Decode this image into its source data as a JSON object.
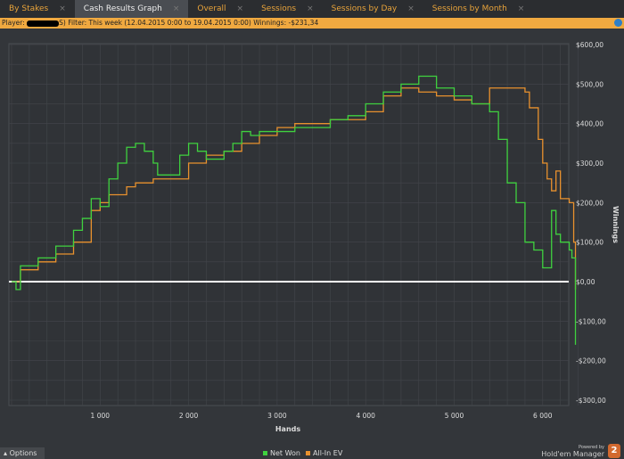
{
  "tabs": [
    {
      "label": "By Stakes"
    },
    {
      "label": "Cash Results Graph",
      "active": true
    },
    {
      "label": "Overall"
    },
    {
      "label": "Sessions"
    },
    {
      "label": "Sessions by Day"
    },
    {
      "label": "Sessions by Month"
    }
  ],
  "close_glyph": "×",
  "filter": {
    "player_label": "Player:",
    "player_suffix": "S)",
    "filter_text": "Filter: This week (12.04.2015 0:00 to 19.04.2015 0:00)",
    "winnings_label": "Winnings:",
    "winnings_value": "-$231,34"
  },
  "footer": {
    "options": "Options",
    "powered_by": "Powered by",
    "brand": "Hold'em Manager",
    "logo": "2"
  },
  "chart_data": {
    "type": "line",
    "xlabel": "Hands",
    "ylabel": "Winnings",
    "xlim": [
      0,
      6400
    ],
    "ylim": [
      -300,
      600
    ],
    "xticks": [
      1000,
      2000,
      3000,
      4000,
      5000,
      6000
    ],
    "xtick_labels": [
      "1 000",
      "2 000",
      "3 000",
      "4 000",
      "5 000",
      "6 000"
    ],
    "yticks": [
      600,
      500,
      400,
      300,
      200,
      100,
      0,
      -100,
      -200,
      -300
    ],
    "ytick_labels": [
      "$600,00",
      "$500,00",
      "$400,00",
      "$300,00",
      "$200,00",
      "$100,00",
      "$0,00",
      "-$100,00",
      "-$200,00",
      "-$300,00"
    ],
    "legend_position": "bottom-center",
    "series": [
      {
        "name": "Net Won",
        "color": "#3fd13f",
        "x": [
          0,
          50,
          100,
          200,
          300,
          500,
          700,
          800,
          900,
          1000,
          1100,
          1200,
          1300,
          1400,
          1500,
          1600,
          1650,
          1800,
          1900,
          2000,
          2100,
          2200,
          2400,
          2500,
          2600,
          2700,
          2800,
          3000,
          3200,
          3400,
          3600,
          3800,
          4000,
          4200,
          4400,
          4600,
          4800,
          5000,
          5200,
          5400,
          5500,
          5600,
          5700,
          5800,
          5900,
          6000,
          6100,
          6150,
          6200,
          6300,
          6330,
          6370
        ],
        "y": [
          0,
          -20,
          40,
          40,
          60,
          90,
          130,
          160,
          210,
          190,
          260,
          300,
          340,
          350,
          330,
          300,
          270,
          270,
          320,
          350,
          330,
          310,
          330,
          350,
          380,
          370,
          380,
          380,
          390,
          390,
          410,
          420,
          450,
          480,
          500,
          520,
          490,
          470,
          450,
          430,
          360,
          250,
          200,
          100,
          80,
          35,
          180,
          120,
          100,
          80,
          60,
          -160
        ]
      },
      {
        "name": "All-In EV",
        "color": "#e8912e",
        "x": [
          0,
          100,
          300,
          500,
          700,
          900,
          1000,
          1100,
          1200,
          1300,
          1400,
          1500,
          1600,
          1800,
          2000,
          2200,
          2400,
          2600,
          2800,
          3000,
          3200,
          3400,
          3600,
          3800,
          4000,
          4200,
          4400,
          4600,
          4800,
          5000,
          5200,
          5400,
          5600,
          5800,
          5850,
          5950,
          6000,
          6050,
          6100,
          6150,
          6200,
          6300,
          6350,
          6370
        ],
        "y": [
          0,
          30,
          50,
          70,
          100,
          180,
          200,
          220,
          220,
          240,
          250,
          250,
          260,
          260,
          300,
          320,
          330,
          350,
          370,
          390,
          400,
          400,
          410,
          410,
          430,
          470,
          490,
          480,
          470,
          460,
          450,
          490,
          490,
          480,
          440,
          360,
          300,
          260,
          230,
          280,
          210,
          200,
          100,
          -20
        ]
      }
    ]
  }
}
